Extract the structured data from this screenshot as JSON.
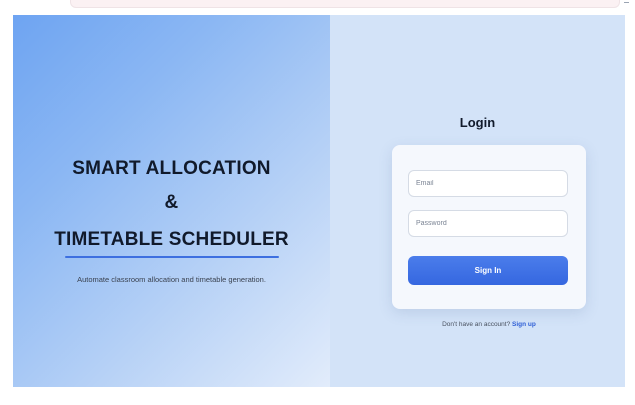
{
  "hero": {
    "line1": "SMART ALLOCATION",
    "line2": "&",
    "line3": "TIMETABLE SCHEDULER",
    "tagline": "Automate classroom allocation and timetable generation."
  },
  "login": {
    "title": "Login",
    "email_placeholder": "Email",
    "password_placeholder": "Password",
    "signin_label": "Sign In",
    "no_account_text": "Don't have an account?",
    "signup_label": "Sign up"
  },
  "colors": {
    "accent": "#3d6fe0",
    "button": "#3f72e6",
    "hero_gradient_start": "#6ea4f2",
    "panel_background": "#d3e3f8"
  }
}
